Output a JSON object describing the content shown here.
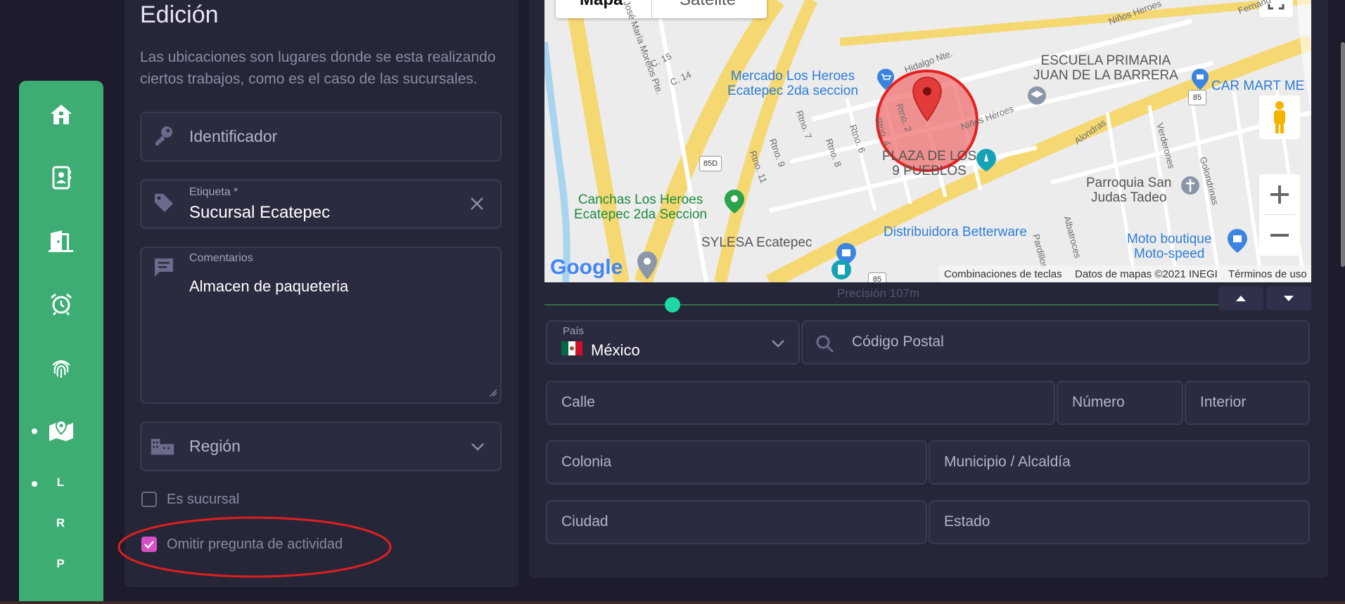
{
  "sidebar": {
    "icons": [
      "home-icon",
      "contacts-icon",
      "door-exit-icon",
      "alarm-clock-icon",
      "fingerprint-icon",
      "map-pin-icon"
    ],
    "letters": [
      "L",
      "R",
      "P"
    ],
    "accent_color": "#3dad74"
  },
  "edit": {
    "title": "Edición",
    "description": "Las ubicaciones son lugares donde se esta realizando ciertos trabajos, como es el caso de las sucursales.",
    "identifier_placeholder": "Identificador",
    "label_label": "Etiqueta *",
    "label_value": "Sucursal Ecatepec",
    "comments_label": "Comentarios",
    "comments_value": "Almacen de paqueteria",
    "region_placeholder": "Región",
    "is_branch_label": "Es sucursal",
    "is_branch_checked": false,
    "skip_question_label": "Omitir pregunta de actividad",
    "skip_question_checked": true,
    "checkbox_color": "#d64fc4"
  },
  "map": {
    "tab_map": "Mapa",
    "tab_satellite": "Satélite",
    "labels": {
      "mercado": "Mercado Los Heroes\nEcatepec 2da seccion",
      "escuela": "ESCUELA PRIMARIA\nJUAN DE LA BARRERA",
      "carmart": "CAR MART ME",
      "plaza": "PLAZA DE LOS\n9 PUEBLOS",
      "canchas": "Canchas Los Heroes\nEcatepec 2da Seccion",
      "sylesa": "SYLESA Ecatepec",
      "betterware": "Distribuidora Betterware",
      "parroquia": "Parroquia San\nJudas Tadeo",
      "moto": "Moto boutique\nMoto-speed",
      "ninos_heroes": "Niños Héroes",
      "ninos_heroes_2": "Niños Heroes",
      "morelos": "José María Morelos Pte.",
      "c15": "C. 15",
      "c14": "C. 14",
      "rtno2": "Rtno. 2",
      "rtno4": "Rtno. 4",
      "rtno6": "Rtno. 6",
      "rtno7": "Rtno. 7",
      "rtno8": "Rtno. 8",
      "rtno9": "Rtno. 9",
      "rtno11": "Rtno. 11",
      "alondras": "Alondras",
      "verderones": "Verderones",
      "golondrinas": "Golondrinas",
      "albatroces": "Albatroces",
      "pardillos": "Pardillos",
      "hidalgo": "Hidalgo Nte.",
      "fernando": "Fernand",
      "shield_85d": "85D",
      "shield_85": "85",
      "shield_85_b": "85"
    },
    "attribution_keys": "Combinaciones de teclas",
    "attribution_data": "Datos de mapas ©2021 INEGI",
    "attribution_terms": "Términos de uso",
    "google": "Google",
    "precision": "Precisión 107m",
    "precision_fraction": 0.19,
    "circle_color": "#f06a6a"
  },
  "address": {
    "country_label": "País",
    "country_value": "México",
    "postal_placeholder": "Código Postal",
    "street_placeholder": "Calle",
    "number_placeholder": "Número",
    "interior_placeholder": "Interior",
    "colony_placeholder": "Colonia",
    "municipality_placeholder": "Municipio / Alcaldía",
    "city_placeholder": "Ciudad",
    "state_placeholder": "Estado"
  }
}
